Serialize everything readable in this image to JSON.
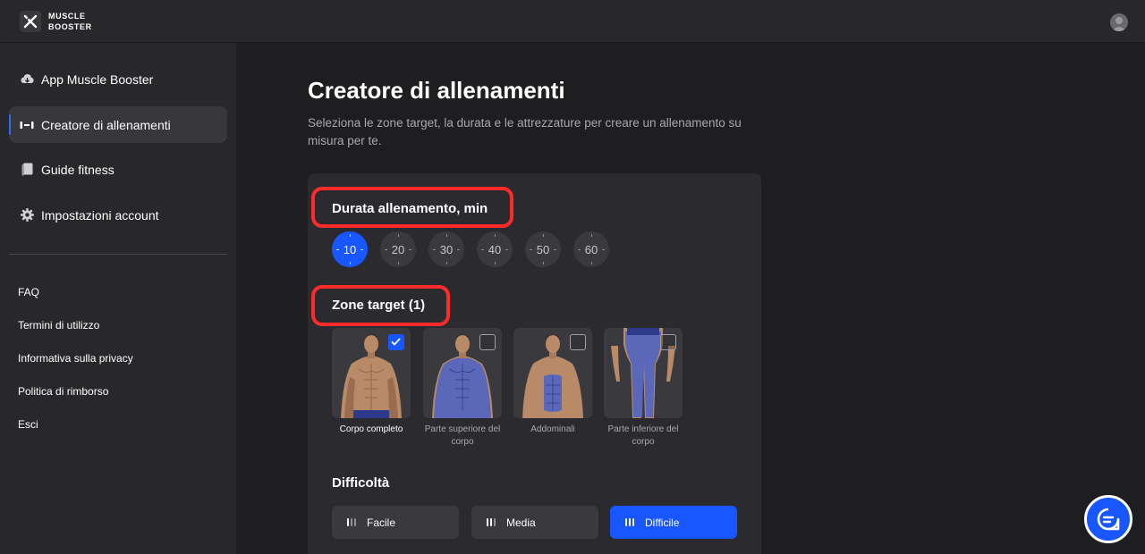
{
  "brand": {
    "line1": "MUSCLE",
    "line2": "BOOSTER"
  },
  "sidebar": {
    "nav": [
      {
        "label": "App Muscle Booster",
        "icon": "download-cloud-icon"
      },
      {
        "label": "Creatore di allenamenti",
        "icon": "dumbbell-icon",
        "active": true
      },
      {
        "label": "Guide fitness",
        "icon": "book-icon"
      },
      {
        "label": "Impostazioni account",
        "icon": "gear-icon"
      }
    ],
    "links": [
      "FAQ",
      "Termini di utilizzo",
      "Informativa sulla privacy",
      "Politica di rimborso",
      "Esci"
    ]
  },
  "main": {
    "title": "Creatore di allenamenti",
    "description": "Seleziona le zone target, la durata e le attrezzature per creare un allenamento su misura per te."
  },
  "duration": {
    "title": "Durata allenamento, min",
    "options": [
      "10",
      "20",
      "30",
      "40",
      "50",
      "60"
    ],
    "selected": "10"
  },
  "zones": {
    "title": "Zone target (1)",
    "items": [
      {
        "label": "Corpo completo",
        "checked": true
      },
      {
        "label": "Parte superiore del corpo",
        "checked": false
      },
      {
        "label": "Addominali",
        "checked": false
      },
      {
        "label": "Parte inferiore del corpo",
        "checked": false
      }
    ]
  },
  "difficulty": {
    "title": "Difficoltà",
    "options": [
      "Facile",
      "Media",
      "Difficile"
    ],
    "selected": "Difficile"
  },
  "colors": {
    "accent": "#1857ff",
    "highlight": "#ff2a2a",
    "background": "#1e1e20",
    "panel": "#28282b"
  }
}
